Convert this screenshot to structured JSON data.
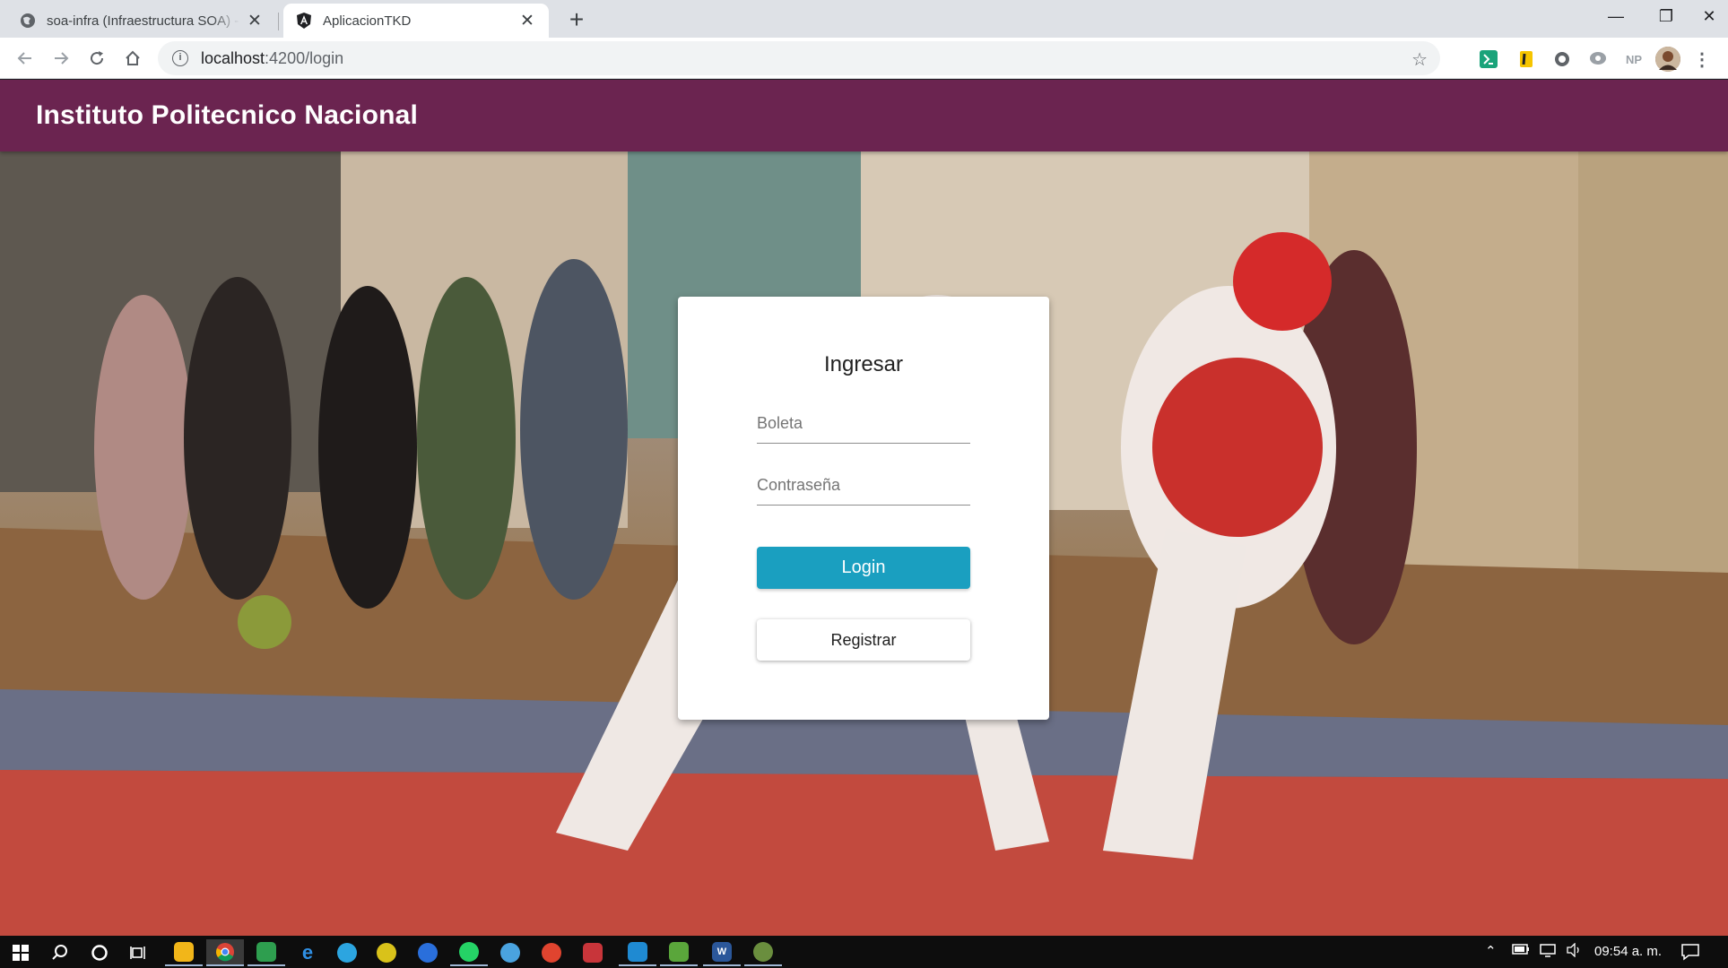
{
  "browser": {
    "tabs": [
      {
        "title": "soa-infra (Infraestructura SOA) - Oracle",
        "favicon": "globe-icon",
        "active": false
      },
      {
        "title": "AplicacionTKD",
        "favicon": "angular-icon",
        "active": true
      }
    ],
    "new_tab_glyph": "+",
    "close_glyph": "✕",
    "window_controls": {
      "minimize": "—",
      "restore": "❐",
      "close": "✕"
    },
    "url_host": "localhost",
    "url_path": ":4200/login",
    "extension_labels": {
      "np": "NP"
    }
  },
  "app": {
    "title": "Instituto Politecnico Nacional",
    "accent_color": "#6b2450"
  },
  "login": {
    "heading": "Ingresar",
    "boleta_placeholder": "Boleta",
    "password_placeholder": "Contraseña",
    "login_label": "Login",
    "register_label": "Registrar",
    "login_color": "#1a9fc0"
  },
  "taskbar": {
    "clock": "09:54 a. m."
  }
}
